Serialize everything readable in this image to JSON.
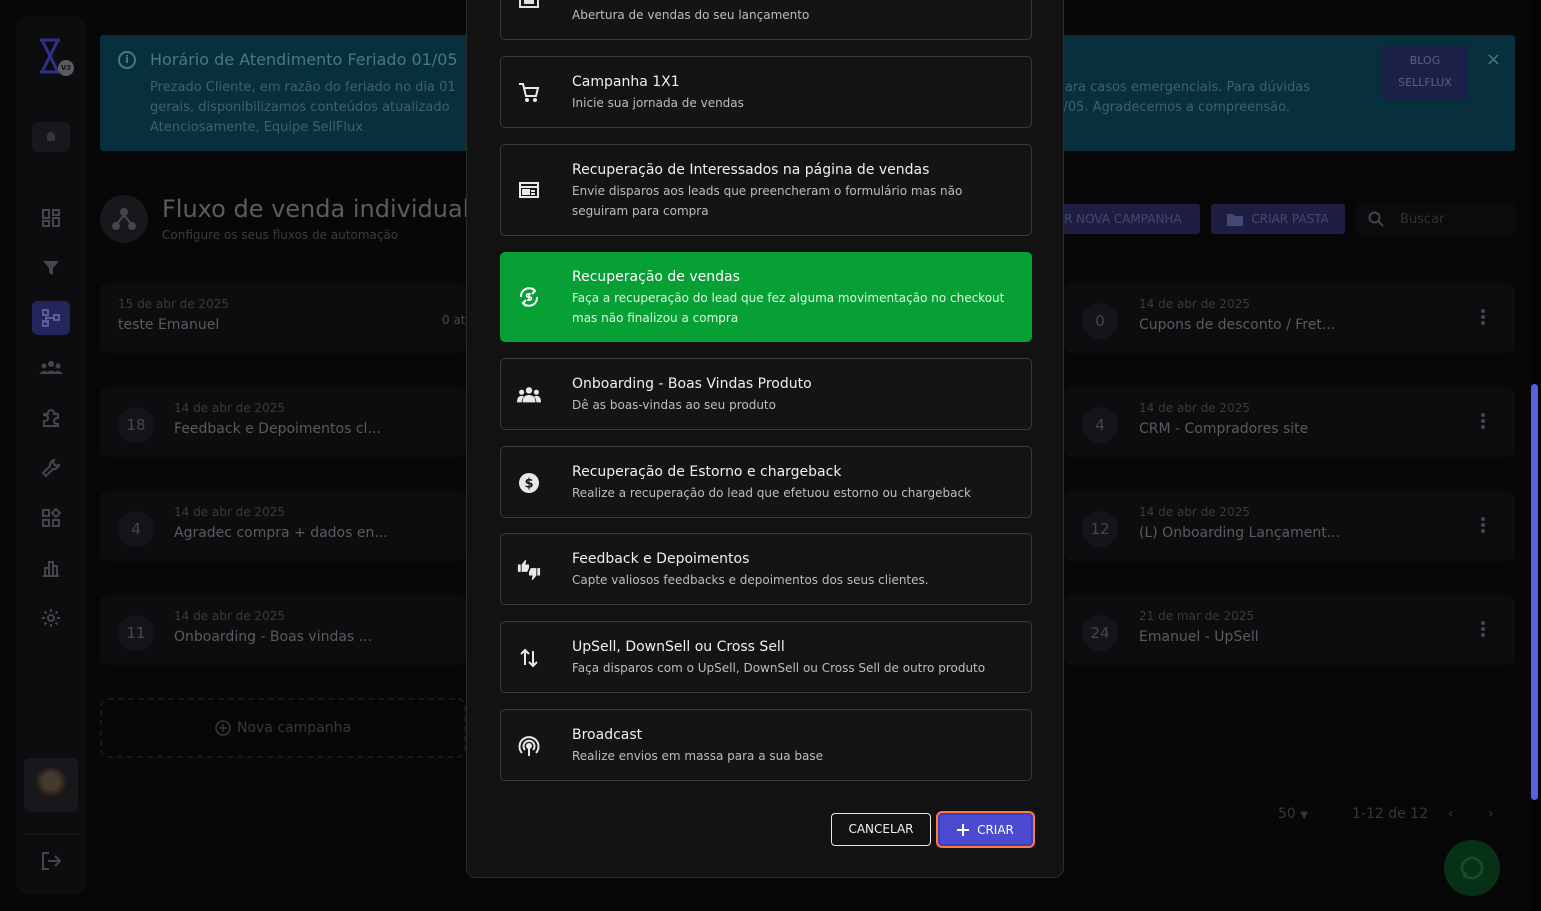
{
  "sidebar": {
    "logo_badge": "V3",
    "icons": [
      "dashboard-icon",
      "funnel-icon",
      "flow-icon",
      "people-icon",
      "puzzle-icon",
      "wrench-icon",
      "apps-icon",
      "chart-icon",
      "gear-icon"
    ],
    "active": "flow-icon"
  },
  "banner": {
    "title": "Horário de Atendimento Feriado 01/05",
    "text_left_1": "Prezado Cliente, em razão do feriado no dia 01",
    "text_left_2": "gerais, disponibilizamos conteúdos atualizado",
    "text_left_3": "Atenciosamente, Equipe SellFlux",
    "text_right_1": "te para casos emergenciais. Para dúvidas",
    "text_right_2": "02/05. Agradecemos a compreensão.",
    "blog_line1": "BLOG",
    "blog_line2": "SELLFLUX",
    "close": "×"
  },
  "header": {
    "title": "Fluxo de venda individual",
    "subtitle": "Configure os seus fluxos de automação",
    "new_campaign_btn": "R NOVA CAMPANHA",
    "new_folder_btn": "CRIAR PASTA",
    "search_placeholder": "Buscar"
  },
  "campaigns_left": [
    {
      "num": "",
      "date": "15 de abr de 2025",
      "name": "teste Emanuel",
      "badge": "0 at"
    },
    {
      "num": "18",
      "date": "14 de abr de 2025",
      "name": "Feedback e Depoimentos cl..."
    },
    {
      "num": "4",
      "date": "14 de abr de 2025",
      "name": "Agradec compra + dados en..."
    },
    {
      "num": "11",
      "date": "14 de abr de 2025",
      "name": "Onboarding - Boas vindas ..."
    }
  ],
  "campaigns_right": [
    {
      "num": "0",
      "date": "14 de abr de 2025",
      "name": "Cupons de desconto / Fret..."
    },
    {
      "num": "4",
      "date": "14 de abr de 2025",
      "name": "CRM - Compradores site"
    },
    {
      "num": "12",
      "date": "14 de abr de 2025",
      "name": "(L) Onboarding Lançament..."
    },
    {
      "num": "24",
      "date": "21 de mar de 2025",
      "name": "Emanuel - UpSell"
    }
  ],
  "new_campaign_card": "Nova campanha",
  "pagination": {
    "per_page": "50",
    "range": "1-12 de 12"
  },
  "modal": {
    "options": [
      {
        "title": "",
        "desc": "Abertura de vendas do seu lançamento",
        "icon": "calendar-icon"
      },
      {
        "title": "Campanha 1X1",
        "desc": "Inicie sua jornada de vendas",
        "icon": "cart-icon"
      },
      {
        "title": "Recuperação de Interessados na página de vendas",
        "desc": "Envie disparos aos leads que preencheram o formulário mas não seguiram para compra",
        "icon": "form-icon"
      },
      {
        "title": "Recuperação de vendas",
        "desc": "Faça a recuperação do lead que fez alguma movimentação no checkout mas não finalizou a compra",
        "icon": "currency-sync-icon",
        "selected": true
      },
      {
        "title": "Onboarding - Boas Vindas Produto",
        "desc": "Dê as boas-vindas ao seu produto",
        "icon": "group-icon"
      },
      {
        "title": "Recuperação de Estorno e chargeback",
        "desc": "Realize a recuperação do lead que efetuou estorno ou chargeback",
        "icon": "dollar-circle-icon"
      },
      {
        "title": "Feedback e Depoimentos",
        "desc": "Capte valiosos feedbacks e depoimentos dos seus clientes.",
        "icon": "thumbs-icon"
      },
      {
        "title": "UpSell, DownSell ou Cross Sell",
        "desc": "Faça disparos com o UpSell, DownSell ou Cross Sell de outro produto",
        "icon": "swap-vertical-icon"
      },
      {
        "title": "Broadcast",
        "desc": "Realize envios em massa para a sua base",
        "icon": "broadcast-icon"
      }
    ],
    "cancel_label": "CANCELAR",
    "create_label": "CRIAR"
  },
  "colors": {
    "selected_option": "#06a034",
    "primary": "#4b4bd1",
    "focus_ring": "#ff7a3d",
    "banner_bg": "#0d4a5c"
  }
}
